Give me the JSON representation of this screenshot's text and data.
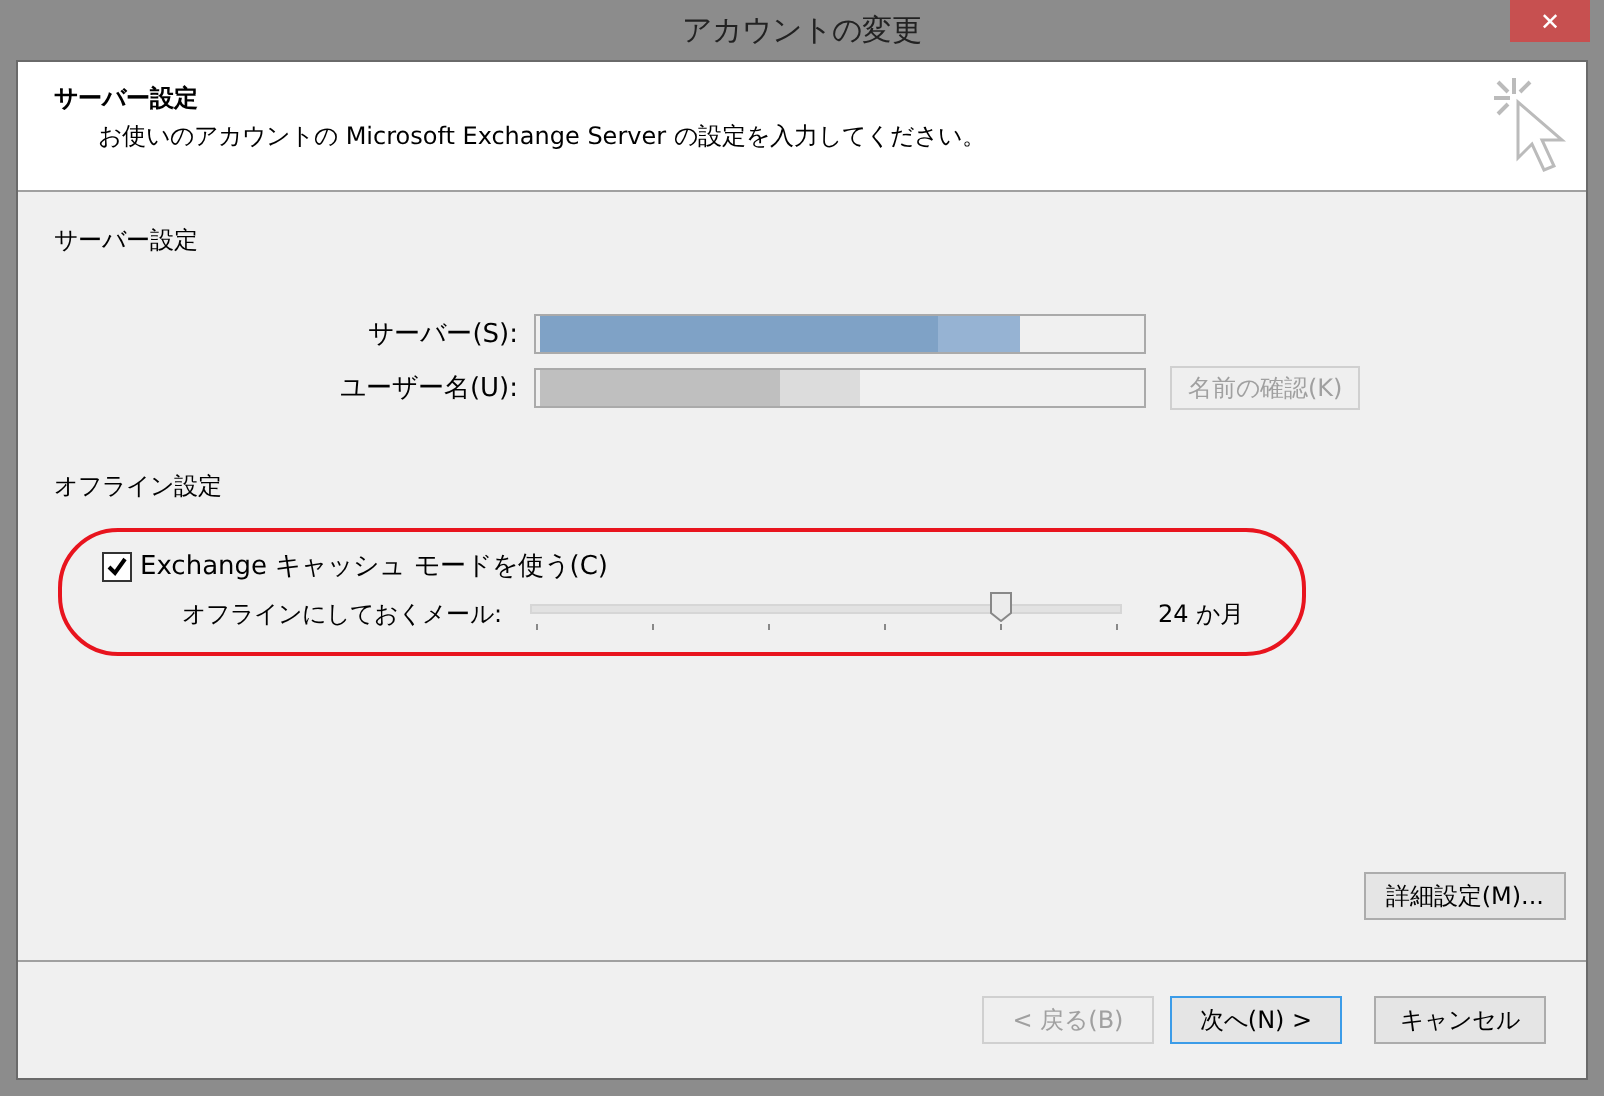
{
  "window": {
    "title": "アカウントの変更",
    "close": "✕"
  },
  "header": {
    "title": "サーバー設定",
    "description": "お使いのアカウントの Microsoft Exchange Server の設定を入力してください。"
  },
  "server_section": {
    "heading": "サーバー設定",
    "fields": [
      {
        "label": "サーバー(S):",
        "redacted": true,
        "kind": "server"
      },
      {
        "label": "ユーザー名(U):",
        "redacted": true,
        "kind": "user"
      }
    ],
    "check_name_button": {
      "label": "名前の確認(K)",
      "disabled": true
    }
  },
  "offline_section": {
    "heading": "オフライン設定",
    "cached_mode": {
      "label": "Exchange キャッシュ モードを使う(C)",
      "checked": true
    },
    "slider": {
      "label": "オフラインにしておくメール:",
      "level": 0.8,
      "reading": "24 か月"
    },
    "highlighted": true
  },
  "more_settings_button": {
    "label": "詳細設定(M)..."
  },
  "buttons": [
    {
      "label": "< 戻る(B)",
      "disabled": true,
      "default": false
    },
    {
      "label": "次へ(N) >",
      "disabled": false,
      "default": true
    },
    {
      "label": "キャンセル",
      "disabled": false,
      "default": false
    }
  ]
}
